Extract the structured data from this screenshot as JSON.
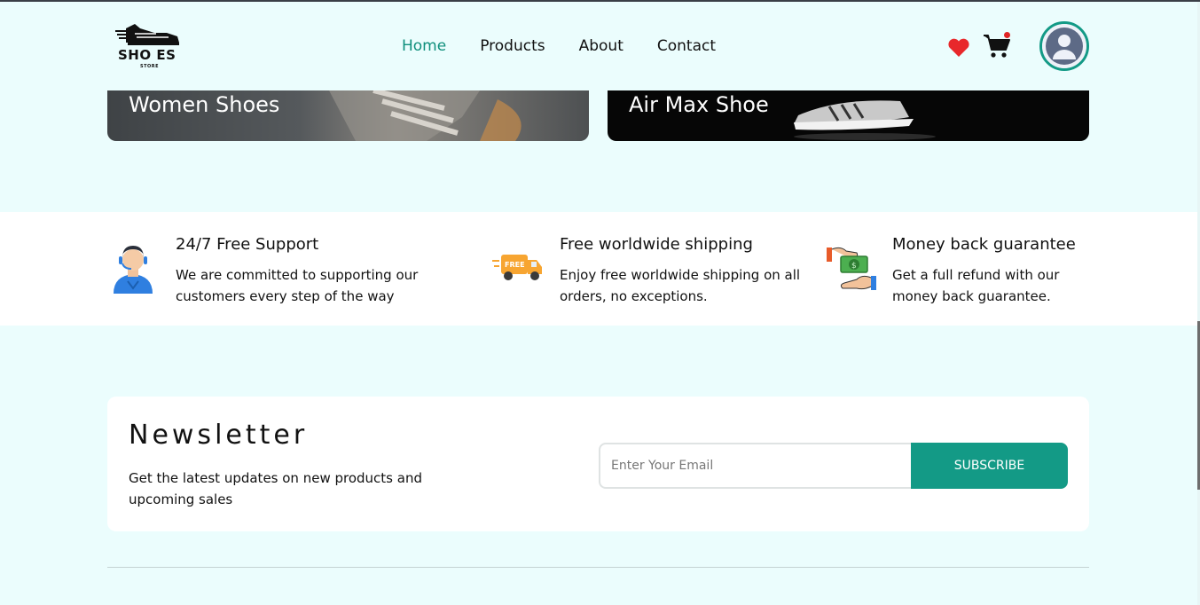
{
  "logo": {
    "text": "SHO ES",
    "sub": "STORE"
  },
  "nav": {
    "items": [
      {
        "label": "Home",
        "active": true
      },
      {
        "label": "Products",
        "active": false
      },
      {
        "label": "About",
        "active": false
      },
      {
        "label": "Contact",
        "active": false
      }
    ]
  },
  "header_icons": {
    "wishlist": "heart-icon",
    "cart": "cart-icon",
    "profile": "avatar-icon",
    "accent": "#139a86"
  },
  "banners": [
    {
      "title": "Women Shoes"
    },
    {
      "title": "Air Max Shoe"
    }
  ],
  "features": [
    {
      "title": "24/7 Free Support",
      "desc": "We are committed to supporting our customers every step of the way",
      "icon": "support-agent-icon"
    },
    {
      "title": "Free worldwide shipping",
      "desc": "Enjoy free worldwide shipping on all orders, no exceptions.",
      "icon": "delivery-truck-icon"
    },
    {
      "title": "Money back guarantee",
      "desc": "Get a full refund with our money back guarantee.",
      "icon": "money-back-icon"
    }
  ],
  "newsletter": {
    "title": "Newsletter",
    "desc": "Get the latest updates on new products and upcoming sales",
    "placeholder": "Enter Your Email",
    "button": "SUBSCRIBE"
  }
}
